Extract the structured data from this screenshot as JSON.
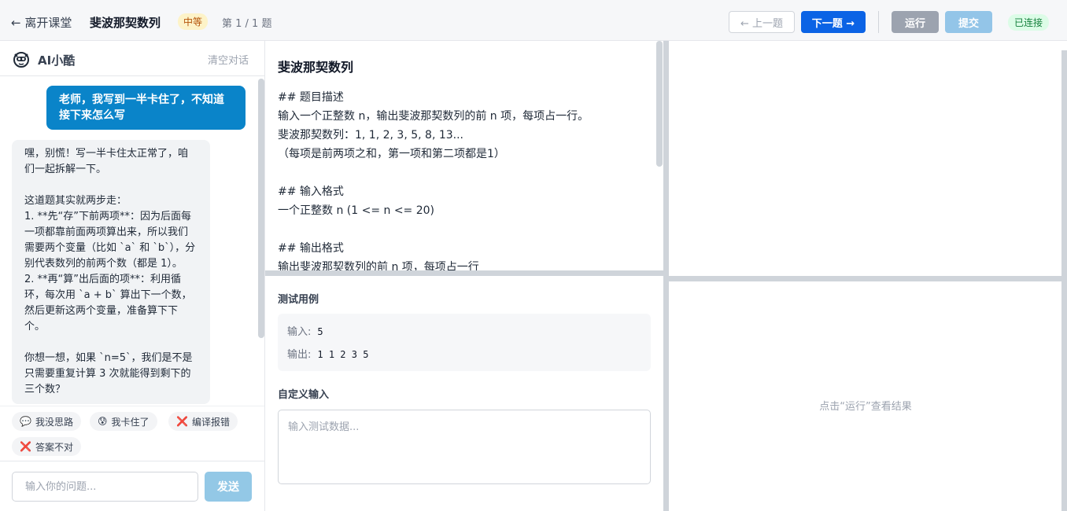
{
  "topbar": {
    "back_label": "← 离开课堂",
    "title": "斐波那契数列",
    "difficulty": "中等",
    "progress": "第 1 / 1 题",
    "prev_label": "← 上一题",
    "next_label": "下一题 →",
    "run_label": "运行",
    "submit_label": "提交",
    "status": "已连接"
  },
  "assistant": {
    "name": "AI小酷",
    "clear_label": "清空对话",
    "messages": [
      {
        "role": "user",
        "text": "老师，我写到一半卡住了，不知道接下来怎么写"
      },
      {
        "role": "ai",
        "text": "嘿，别慌！写一半卡住太正常了，咱们一起拆解一下。\n\n这道题其实就两步走：\n1. **先“存”下前两项**：因为后面每一项都靠前面两项算出来，所以我们需要两个变量（比如 `a` 和 `b`），分别代表数列的前两个数（都是 1）。\n2. **再“算”出后面的项**：利用循环，每次用 `a + b` 算出下一个数，然后更新这两个变量，准备算下下个。\n\n你想一想，如果 `n=5`，我们是不是只需要重复计算 3 次就能得到剩下的三个数？"
      }
    ],
    "quick_actions": [
      {
        "icon": "💬",
        "label": "我没思路"
      },
      {
        "icon": "😰",
        "label": "我卡住了"
      },
      {
        "icon": "❌",
        "label": "编译报错"
      },
      {
        "icon": "❌",
        "label": "答案不对"
      }
    ],
    "input_placeholder": "输入你的问题...",
    "send_label": "发送"
  },
  "problem": {
    "title": "斐波那契数列",
    "lines": [
      "## 题目描述",
      "输入一个正整数 n，输出斐波那契数列的前 n 项，每项占一行。",
      "斐波那契数列：1, 1, 2, 3, 5, 8, 13...",
      "（每项是前两项之和，第一项和第二项都是1）",
      "",
      "## 输入格式",
      "一个正整数 n (1 <= n <= 20)",
      "",
      "## 输出格式",
      "输出斐波那契数列的前 n 项，每项占一行"
    ]
  },
  "tests": {
    "label": "测试用例",
    "input_label": "输入:",
    "input_value": "5",
    "output_label": "输出:",
    "output_value": "1 1 2 3 5",
    "custom_label": "自定义输入",
    "custom_placeholder": "输入测试数据..."
  },
  "result": {
    "hint": "点击“运行”查看结果"
  }
}
